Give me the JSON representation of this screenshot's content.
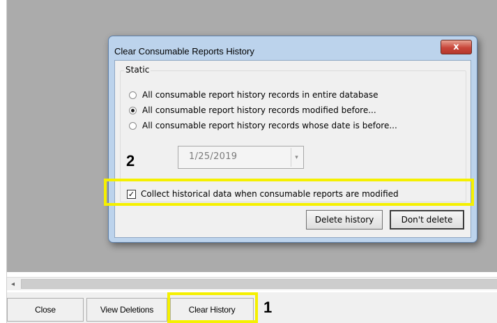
{
  "main": {
    "scroll_left_glyph": "◂"
  },
  "toolbar": {
    "close_label": "Close",
    "view_deletions_label": "View Deletions",
    "clear_history_label": "Clear History"
  },
  "callouts": {
    "one": "1",
    "two": "2"
  },
  "dialog": {
    "title": "Clear Consumable Reports History",
    "close_glyph": "x",
    "group_label": "Static",
    "options": [
      {
        "label": "All consumable report history records in entire database",
        "selected": false
      },
      {
        "label": "All consumable report history records modified before...",
        "selected": true
      },
      {
        "label": "All consumable report history records whose date is before...",
        "selected": false
      }
    ],
    "date_value": "1/25/2019",
    "dropdown_glyph": "▾",
    "collect_label": "Collect historical data when consumable reports are modified",
    "collect_checked": true,
    "check_glyph": "✓",
    "delete_label": "Delete history",
    "dont_delete_label": "Don't delete"
  },
  "colors": {
    "highlight": "#f5f000",
    "dialog_frame": "#bcd3ec",
    "close_button": "#c8463a",
    "backdrop": "#ababab"
  }
}
